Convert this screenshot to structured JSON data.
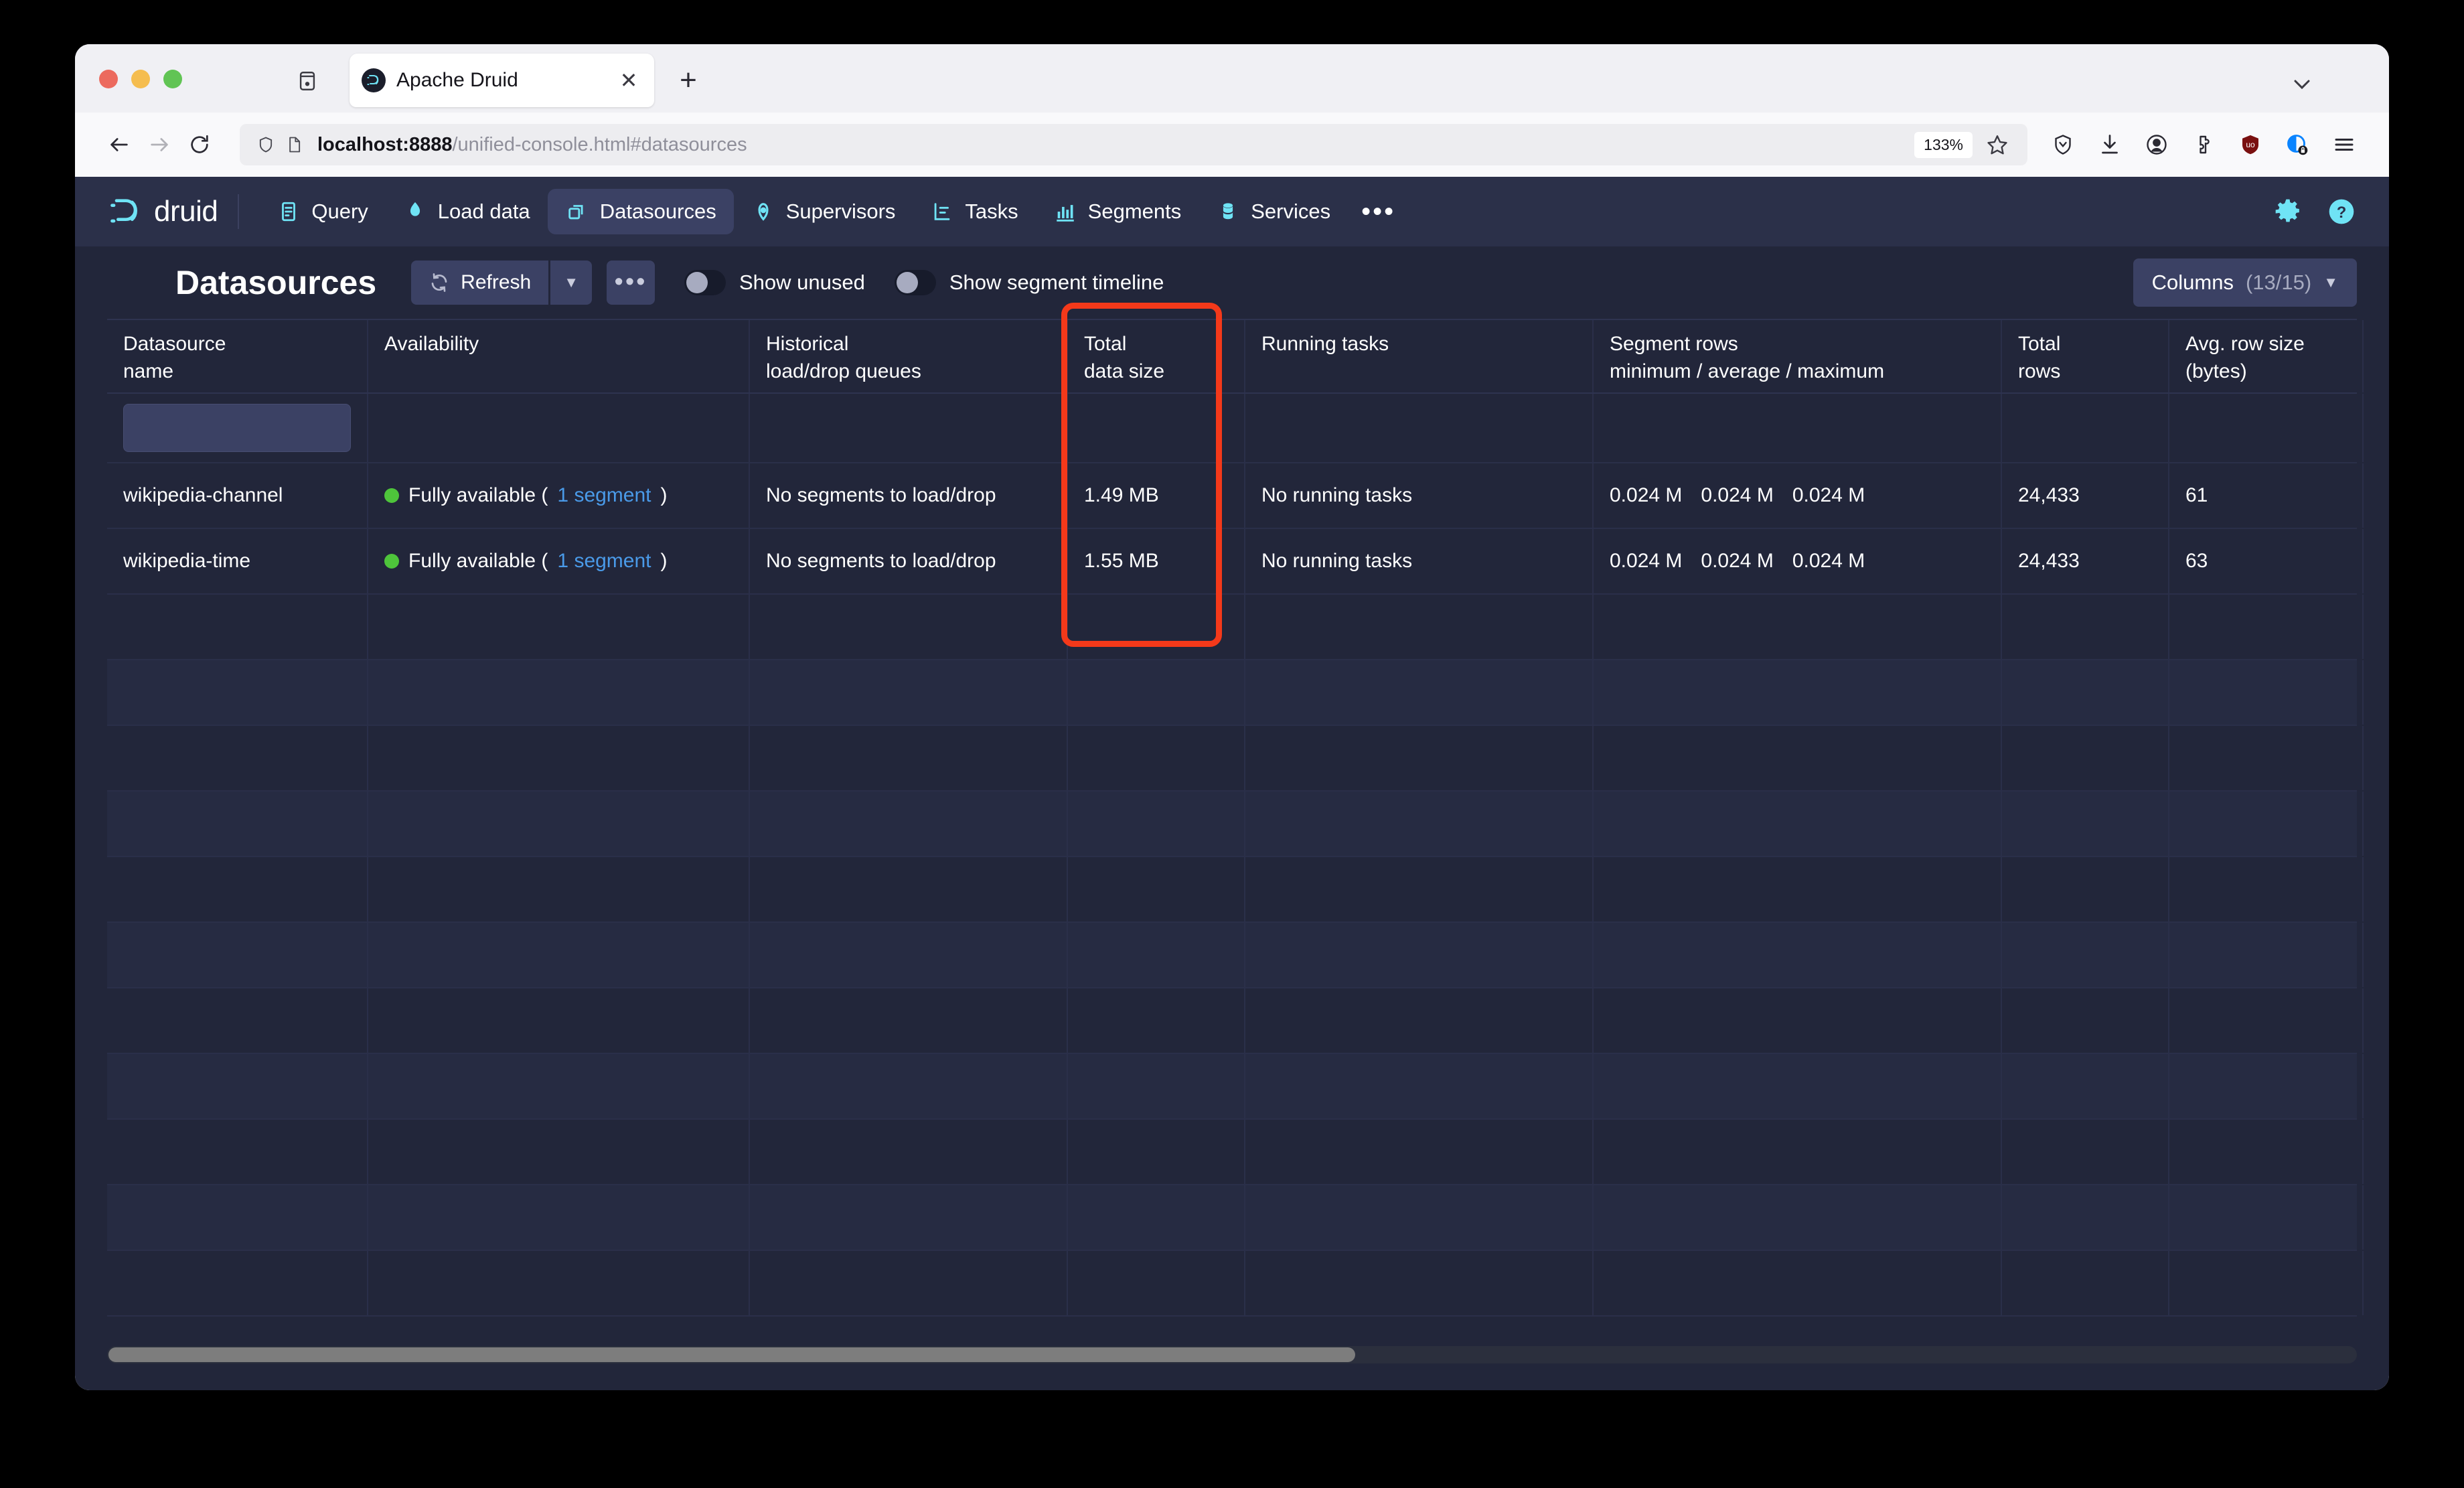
{
  "browser": {
    "tab": {
      "title": "Apache Druid",
      "favicon": "druid-favicon",
      "close_label": "✕"
    },
    "newtab_label": "+",
    "url": {
      "host": "localhost:8888",
      "path": "/unified-console.html#datasources"
    },
    "zoom_level": "133%",
    "toolbar_icons": [
      "shield-icon",
      "download-icon",
      "account-icon",
      "extensions-icon",
      "ublock-origin-icon",
      "container-lock-icon",
      "app-menu-icon"
    ]
  },
  "app": {
    "logo_text": "druid",
    "nav": [
      {
        "label": "Query",
        "icon": "query-icon",
        "active": false
      },
      {
        "label": "Load data",
        "icon": "load-data-icon",
        "active": false
      },
      {
        "label": "Datasources",
        "icon": "datasources-icon",
        "active": true
      },
      {
        "label": "Supervisors",
        "icon": "supervisors-icon",
        "active": false
      },
      {
        "label": "Tasks",
        "icon": "tasks-icon",
        "active": false
      },
      {
        "label": "Segments",
        "icon": "segments-icon",
        "active": false
      },
      {
        "label": "Services",
        "icon": "services-icon",
        "active": false
      }
    ],
    "nav_more_label": "•••",
    "nav_right": [
      "gear-icon",
      "help-icon"
    ]
  },
  "toolbar": {
    "page_title": "Datasources",
    "refresh_label": "Refresh",
    "refresh_caret": "▼",
    "more_label": "•••",
    "toggles": [
      {
        "label": "Show unused",
        "on": false
      },
      {
        "label": "Show segment timeline",
        "on": false
      }
    ],
    "columns_label": "Columns",
    "columns_count": "(13/15)",
    "columns_caret": "▼"
  },
  "table": {
    "headers": [
      {
        "line1": "Datasource",
        "line2": "name"
      },
      {
        "line1": "Availability",
        "line2": ""
      },
      {
        "line1": "Historical",
        "line2": "load/drop queues"
      },
      {
        "line1": "Total",
        "line2": "data size"
      },
      {
        "line1": "Running tasks",
        "line2": ""
      },
      {
        "line1": "Segment rows",
        "line2": "minimum / average / maximum"
      },
      {
        "line1": "Total",
        "line2": "rows"
      },
      {
        "line1": "Avg. row size",
        "line2": "(bytes)"
      }
    ],
    "filter_placeholder": "",
    "rows": [
      {
        "name": "wikipedia-channel",
        "availability_prefix": "Fully available (",
        "availability_link": "1 segment",
        "availability_suffix": ")",
        "queues": "No segments to load/drop",
        "total_data_size": "1.49 MB",
        "running_tasks": "No running tasks",
        "segment_rows_min": "0.024 M",
        "segment_rows_avg": "0.024 M",
        "segment_rows_max": "0.024 M",
        "total_rows": "24,433",
        "avg_row_size": "61"
      },
      {
        "name": "wikipedia-time",
        "availability_prefix": "Fully available (",
        "availability_link": "1 segment",
        "availability_suffix": ")",
        "queues": "No segments to load/drop",
        "total_data_size": "1.55 MB",
        "running_tasks": "No running tasks",
        "segment_rows_min": "0.024 M",
        "segment_rows_avg": "0.024 M",
        "segment_rows_max": "0.024 M",
        "total_rows": "24,433",
        "avg_row_size": "63"
      }
    ],
    "empty_row_count": 11
  },
  "annotation": {
    "highlight_color": "#f4391a",
    "highlight_target": "Total data size column"
  },
  "colors": {
    "app_bg": "#22263a",
    "nav_bg": "#2b3049",
    "accent_cyan": "#6fe3f5",
    "link_blue": "#4a9ae8",
    "status_green": "#4ec43b"
  }
}
